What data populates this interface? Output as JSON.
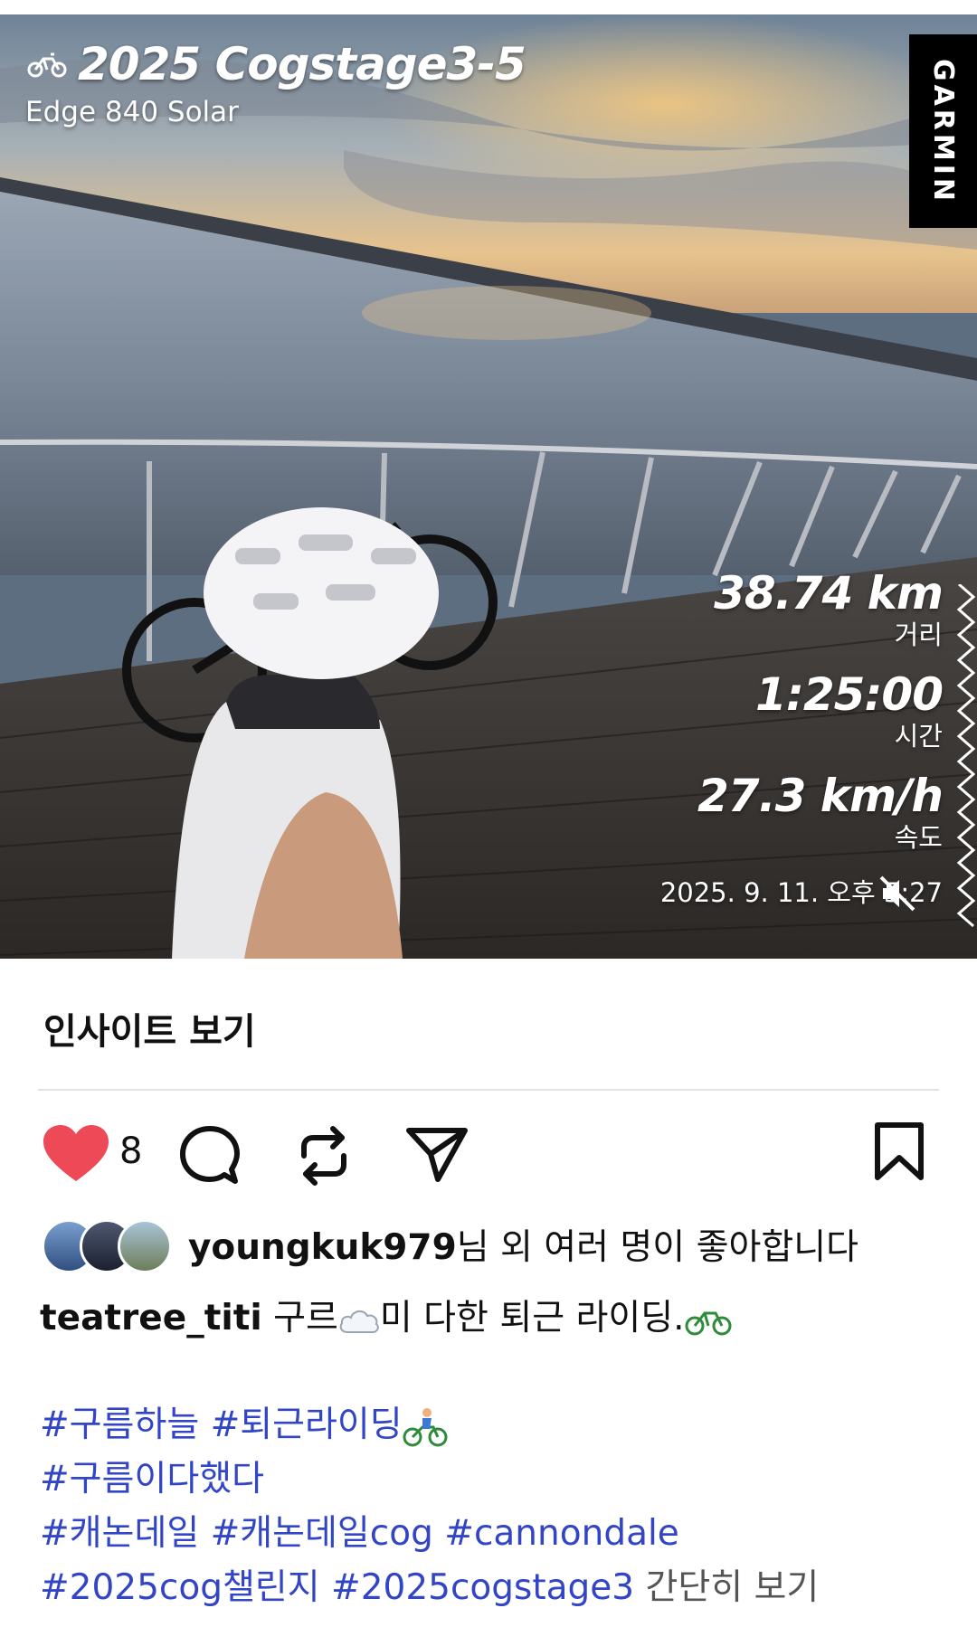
{
  "photo": {
    "activity_title": "2025 Cogstage3-5",
    "device": "Edge 840 Solar",
    "brand": "GARMIN",
    "stats": [
      {
        "value": "38.74 km",
        "label": "거리"
      },
      {
        "value": "1:25:00",
        "label": "시간"
      },
      {
        "value": "27.3 km/h",
        "label": "속도"
      }
    ],
    "datetime": "2025. 9. 11. 오후 5:27"
  },
  "insights": {
    "label": "인사이트 보기"
  },
  "actions": {
    "like_count": "8",
    "icons": [
      "heart-icon",
      "comment-icon",
      "repost-icon",
      "share-icon",
      "bookmark-icon"
    ],
    "like_color": "#ed4956"
  },
  "likers": {
    "username": "youngkuk979",
    "suffix": "님 외 여러 명이 좋아합니다"
  },
  "caption": {
    "username": "teatree_titi",
    "text_a": "구르",
    "text_b": "미 다한  퇴근 라이딩."
  },
  "hashtags": {
    "line1": [
      "#구름하늘",
      "#퇴근라이딩"
    ],
    "line2": [
      "#구름이다했다"
    ],
    "line3": [
      "#캐논데일",
      "#캐논데일cog",
      "#cannondale"
    ],
    "line4": [
      "#2025cog챌린지",
      "#2025cogstage3"
    ],
    "more": "간단히 보기",
    "link_color": "#3245c6"
  }
}
